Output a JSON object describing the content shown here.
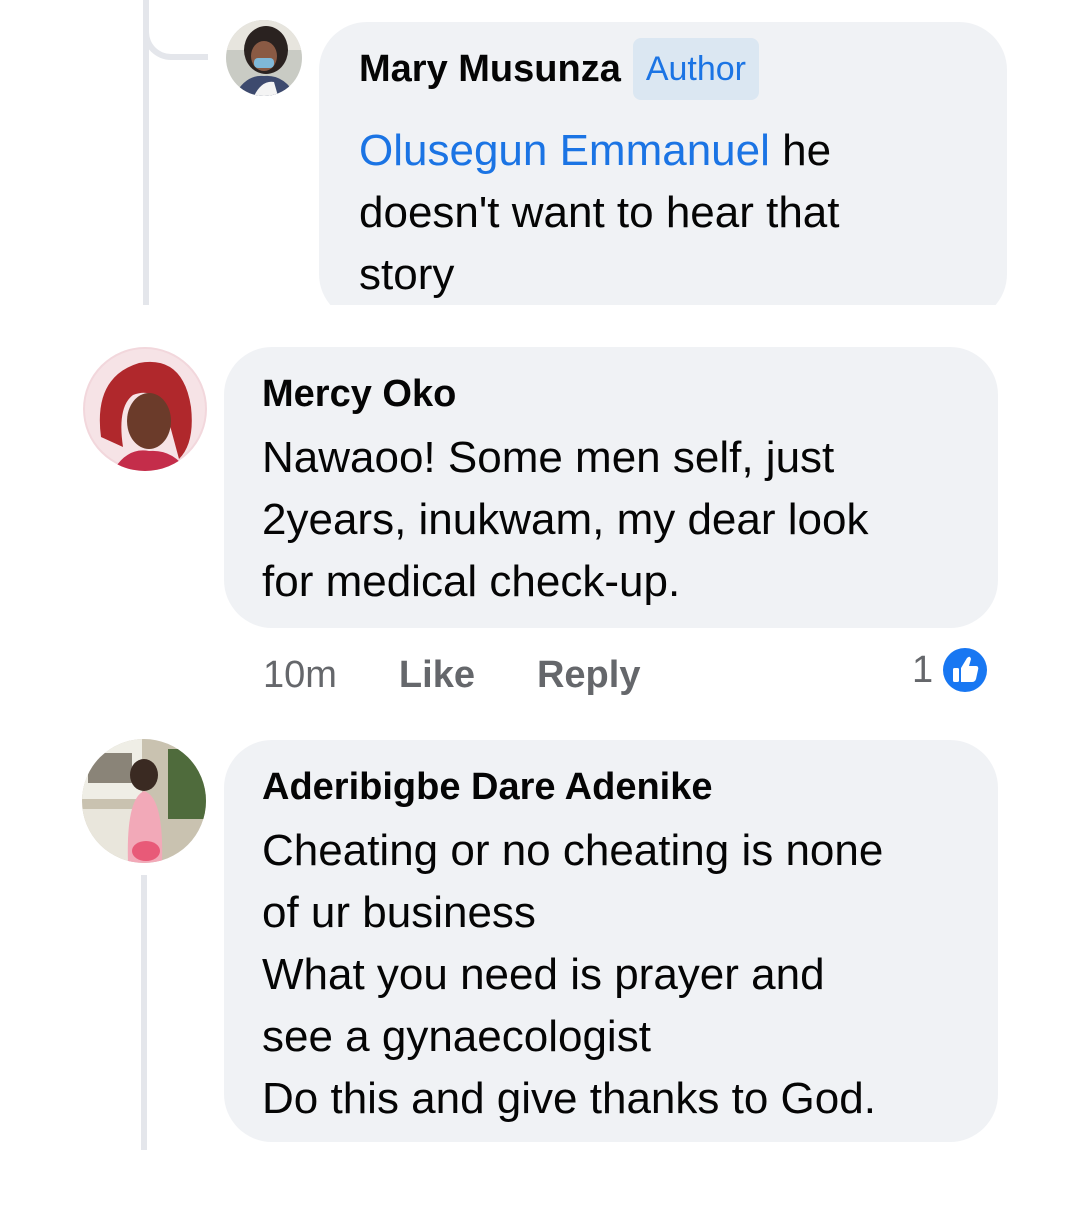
{
  "comments": [
    {
      "author": "Mary Musunza",
      "badge": "Author",
      "mention": "Olusegun Emmanuel",
      "text_line1_rest": " he",
      "text_rest": "doesn't want to  hear that\nstory"
    },
    {
      "author": "Mercy Oko",
      "text": "Nawaoo! Some men self, just\n2years, inukwam, my dear look\nfor medical check-up.",
      "time": "10m",
      "like_label": "Like",
      "reply_label": "Reply",
      "reaction_count": "1",
      "reaction_icon": "like-reaction-icon"
    },
    {
      "author": "Aderibigbe Dare Adenike",
      "text": "Cheating or no cheating is none\nof ur business\nWhat you need is prayer and\nsee a gynaecologist\nDo this and give thanks to God."
    }
  ],
  "colors": {
    "bubble": "#f0f2f5",
    "mention": "#1b74e4",
    "badge_bg": "#dbe7f2",
    "meta": "#65676b",
    "like_blue": "#1877f2",
    "thread_line": "#e4e6eb"
  }
}
